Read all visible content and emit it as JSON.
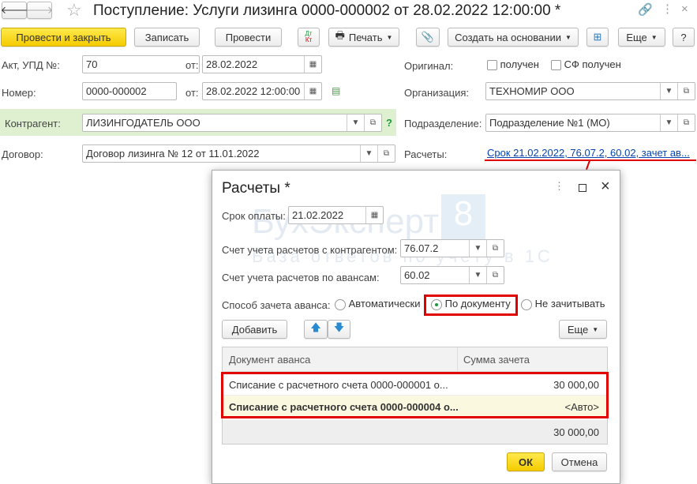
{
  "window": {
    "title": "Поступление: Услуги лизинга 0000-000002 от 28.02.2022 12:00:00 *"
  },
  "toolbar": {
    "post_close": "Провести и закрыть",
    "save": "Записать",
    "post": "Провести",
    "dtkt_dt": "Дт",
    "dtkt_kt": "Кт",
    "print": "Печать",
    "create_based": "Создать на основании",
    "more": "Еще",
    "help": "?"
  },
  "form": {
    "act_label": "Акт, УПД №:",
    "act_value": "70",
    "from_label": "от:",
    "act_date": "28.02.2022",
    "number_label": "Номер:",
    "number_value": "0000-000002",
    "number_date": "28.02.2022 12:00:00",
    "counterparty_label": "Контрагент:",
    "counterparty_value": "ЛИЗИНГОДАТЕЛЬ ООО",
    "contract_label": "Договор:",
    "contract_value": "Договор лизинга № 12 от 11.01.2022",
    "original_label": "Оригинал:",
    "received": "получен",
    "sf_received": "СФ получен",
    "org_label": "Организация:",
    "org_value": "ТЕХНОМИР ООО",
    "division_label": "Подразделение:",
    "division_value": "Подразделение №1 (МО)",
    "settlements_label": "Расчеты:",
    "settlements_link": "Срок 21.02.2022, 76.07.2, 60.02, зачет ав..."
  },
  "dialog": {
    "title": "Расчеты *",
    "due_label": "Срок оплаты:",
    "due_value": "21.02.2022",
    "acc_cp_label": "Счет учета расчетов с контрагентом:",
    "acc_cp_value": "76.07.2",
    "acc_adv_label": "Счет учета расчетов по авансам:",
    "acc_adv_value": "60.02",
    "method_label": "Способ зачета аванса:",
    "methods": [
      {
        "label": "Автоматически",
        "selected": false
      },
      {
        "label": "По документу",
        "selected": true
      },
      {
        "label": "Не зачитывать",
        "selected": false
      }
    ],
    "add": "Добавить",
    "more": "Еще",
    "columns": [
      "Документ аванса",
      "Сумма зачета"
    ],
    "rows": [
      {
        "doc": "Списание с расчетного счета 0000-000001 о...",
        "sum": "30 000,00"
      },
      {
        "doc": "Списание с расчетного счета 0000-000004 о...",
        "sum": "<Авто>"
      }
    ],
    "total": "30 000,00",
    "ok": "ОК",
    "cancel": "Отмена"
  },
  "watermark": {
    "brand": "БухЭксперт",
    "num": "8",
    "tagline": "База ответов по учёту в 1С"
  },
  "colors": {
    "accent_yellow": "#f5cc00",
    "highlight_red": "#e00000",
    "counterparty_bg": "#dff0d0",
    "link_blue": "#0645ad"
  }
}
